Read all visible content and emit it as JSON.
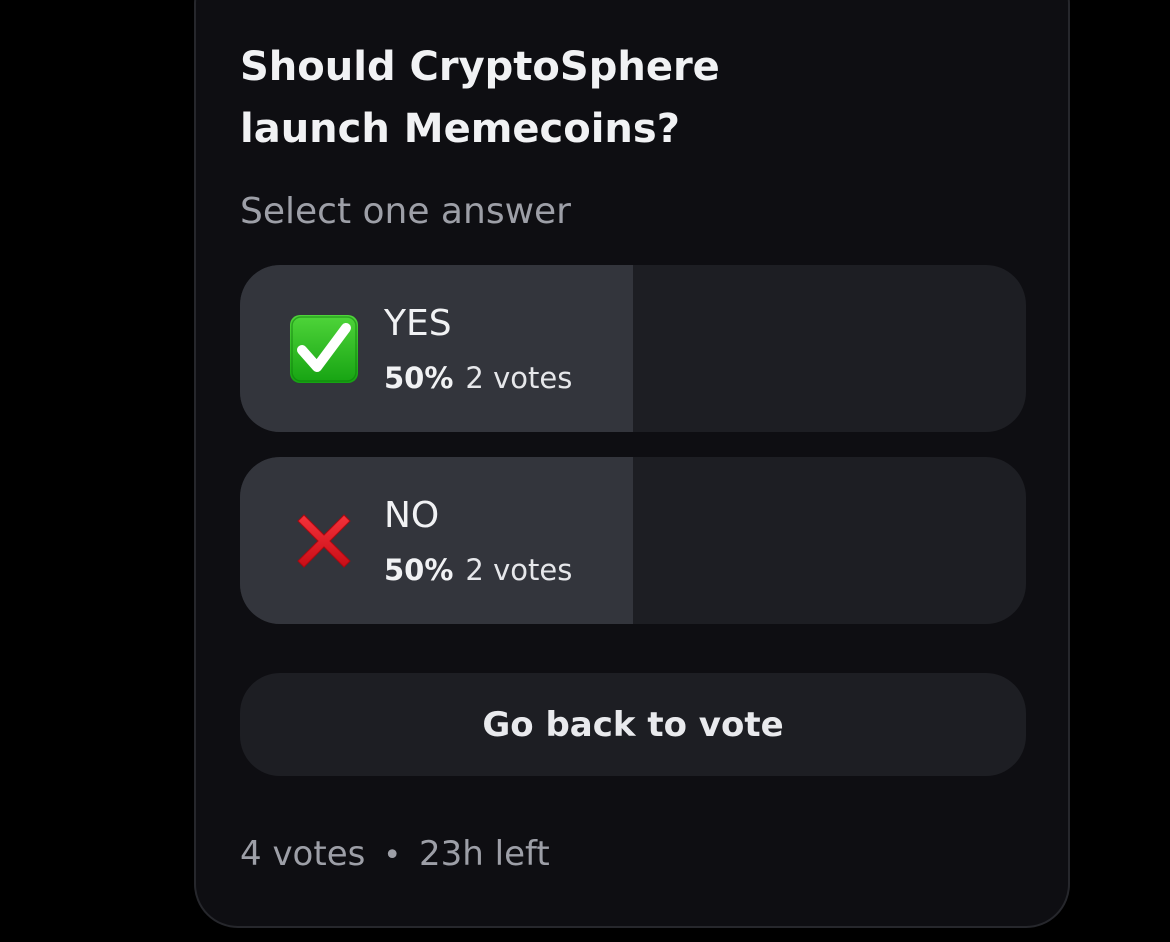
{
  "poll": {
    "question": "Should CryptoSphere launch Memecoins?",
    "instruction": "Select one answer",
    "options": [
      {
        "icon": "check-mark-button-icon",
        "label": "YES",
        "percent": "50%",
        "votes": "2 votes",
        "share": 0.5
      },
      {
        "icon": "cross-mark-icon",
        "label": "NO",
        "percent": "50%",
        "votes": "2 votes",
        "share": 0.5
      }
    ],
    "back_button_label": "Go back to vote",
    "footer": {
      "total_votes": "4 votes",
      "separator": "•",
      "time_left": "23h left"
    }
  },
  "colors": {
    "page_background": "#000000",
    "card_background": "#0e0e12",
    "option_background": "#1d1e23",
    "option_fill": "#33353c",
    "check_green": "#21b21e",
    "cross_red": "#e0141e"
  }
}
